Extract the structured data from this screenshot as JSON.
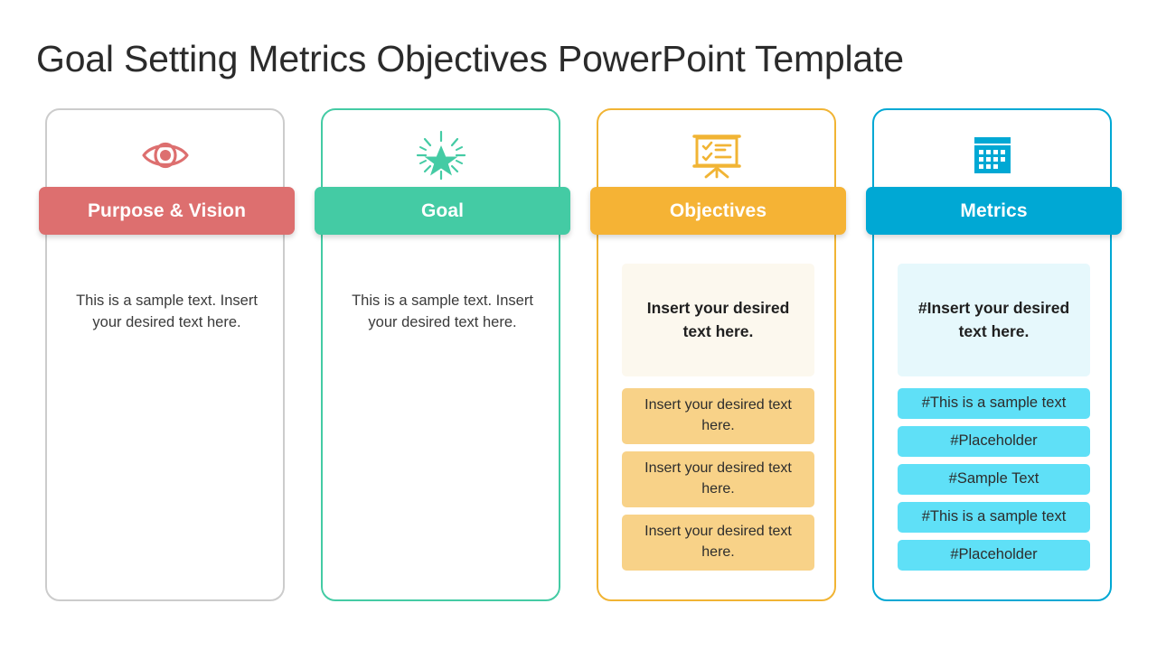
{
  "title": "Goal Setting Metrics Objectives PowerPoint Template",
  "cards": [
    {
      "id": "purpose-vision",
      "header": "Purpose & Vision",
      "icon": "eye-icon",
      "color": "#DD6F6F",
      "border_color": "#DD6F6F",
      "body": "This is a sample text. Insert your desired text here.",
      "lead": null,
      "lead_bg": null,
      "items": [],
      "item_bg": null
    },
    {
      "id": "goal",
      "header": "Goal",
      "icon": "shining-star-icon",
      "color": "#44CBA4",
      "border_color": "#44CBA4",
      "body": "This is a sample text. Insert your desired text here.",
      "lead": null,
      "lead_bg": null,
      "items": [],
      "item_bg": null
    },
    {
      "id": "objectives",
      "header": "Objectives",
      "icon": "presentation-checklist-icon",
      "color": "#F5B335",
      "border_color": "#F1B434",
      "body": null,
      "lead": "Insert your desired text here.",
      "lead_bg": "#FCF8EE",
      "items": [
        "Insert your desired text here.",
        "Insert your desired text here.",
        "Insert your desired text here."
      ],
      "item_bg": "#F8D288"
    },
    {
      "id": "metrics",
      "header": "Metrics",
      "icon": "calendar-grid-icon",
      "color": "#00A8D4",
      "border_color": "#00A8D4",
      "body": null,
      "lead": "#Insert your desired text here.",
      "lead_bg": "#E6F8FC",
      "items": [
        "#This is a sample text",
        "#Placeholder",
        "#Sample Text",
        "#This is a sample text",
        "#Placeholder"
      ],
      "item_bg": "#5FE0F7"
    }
  ]
}
